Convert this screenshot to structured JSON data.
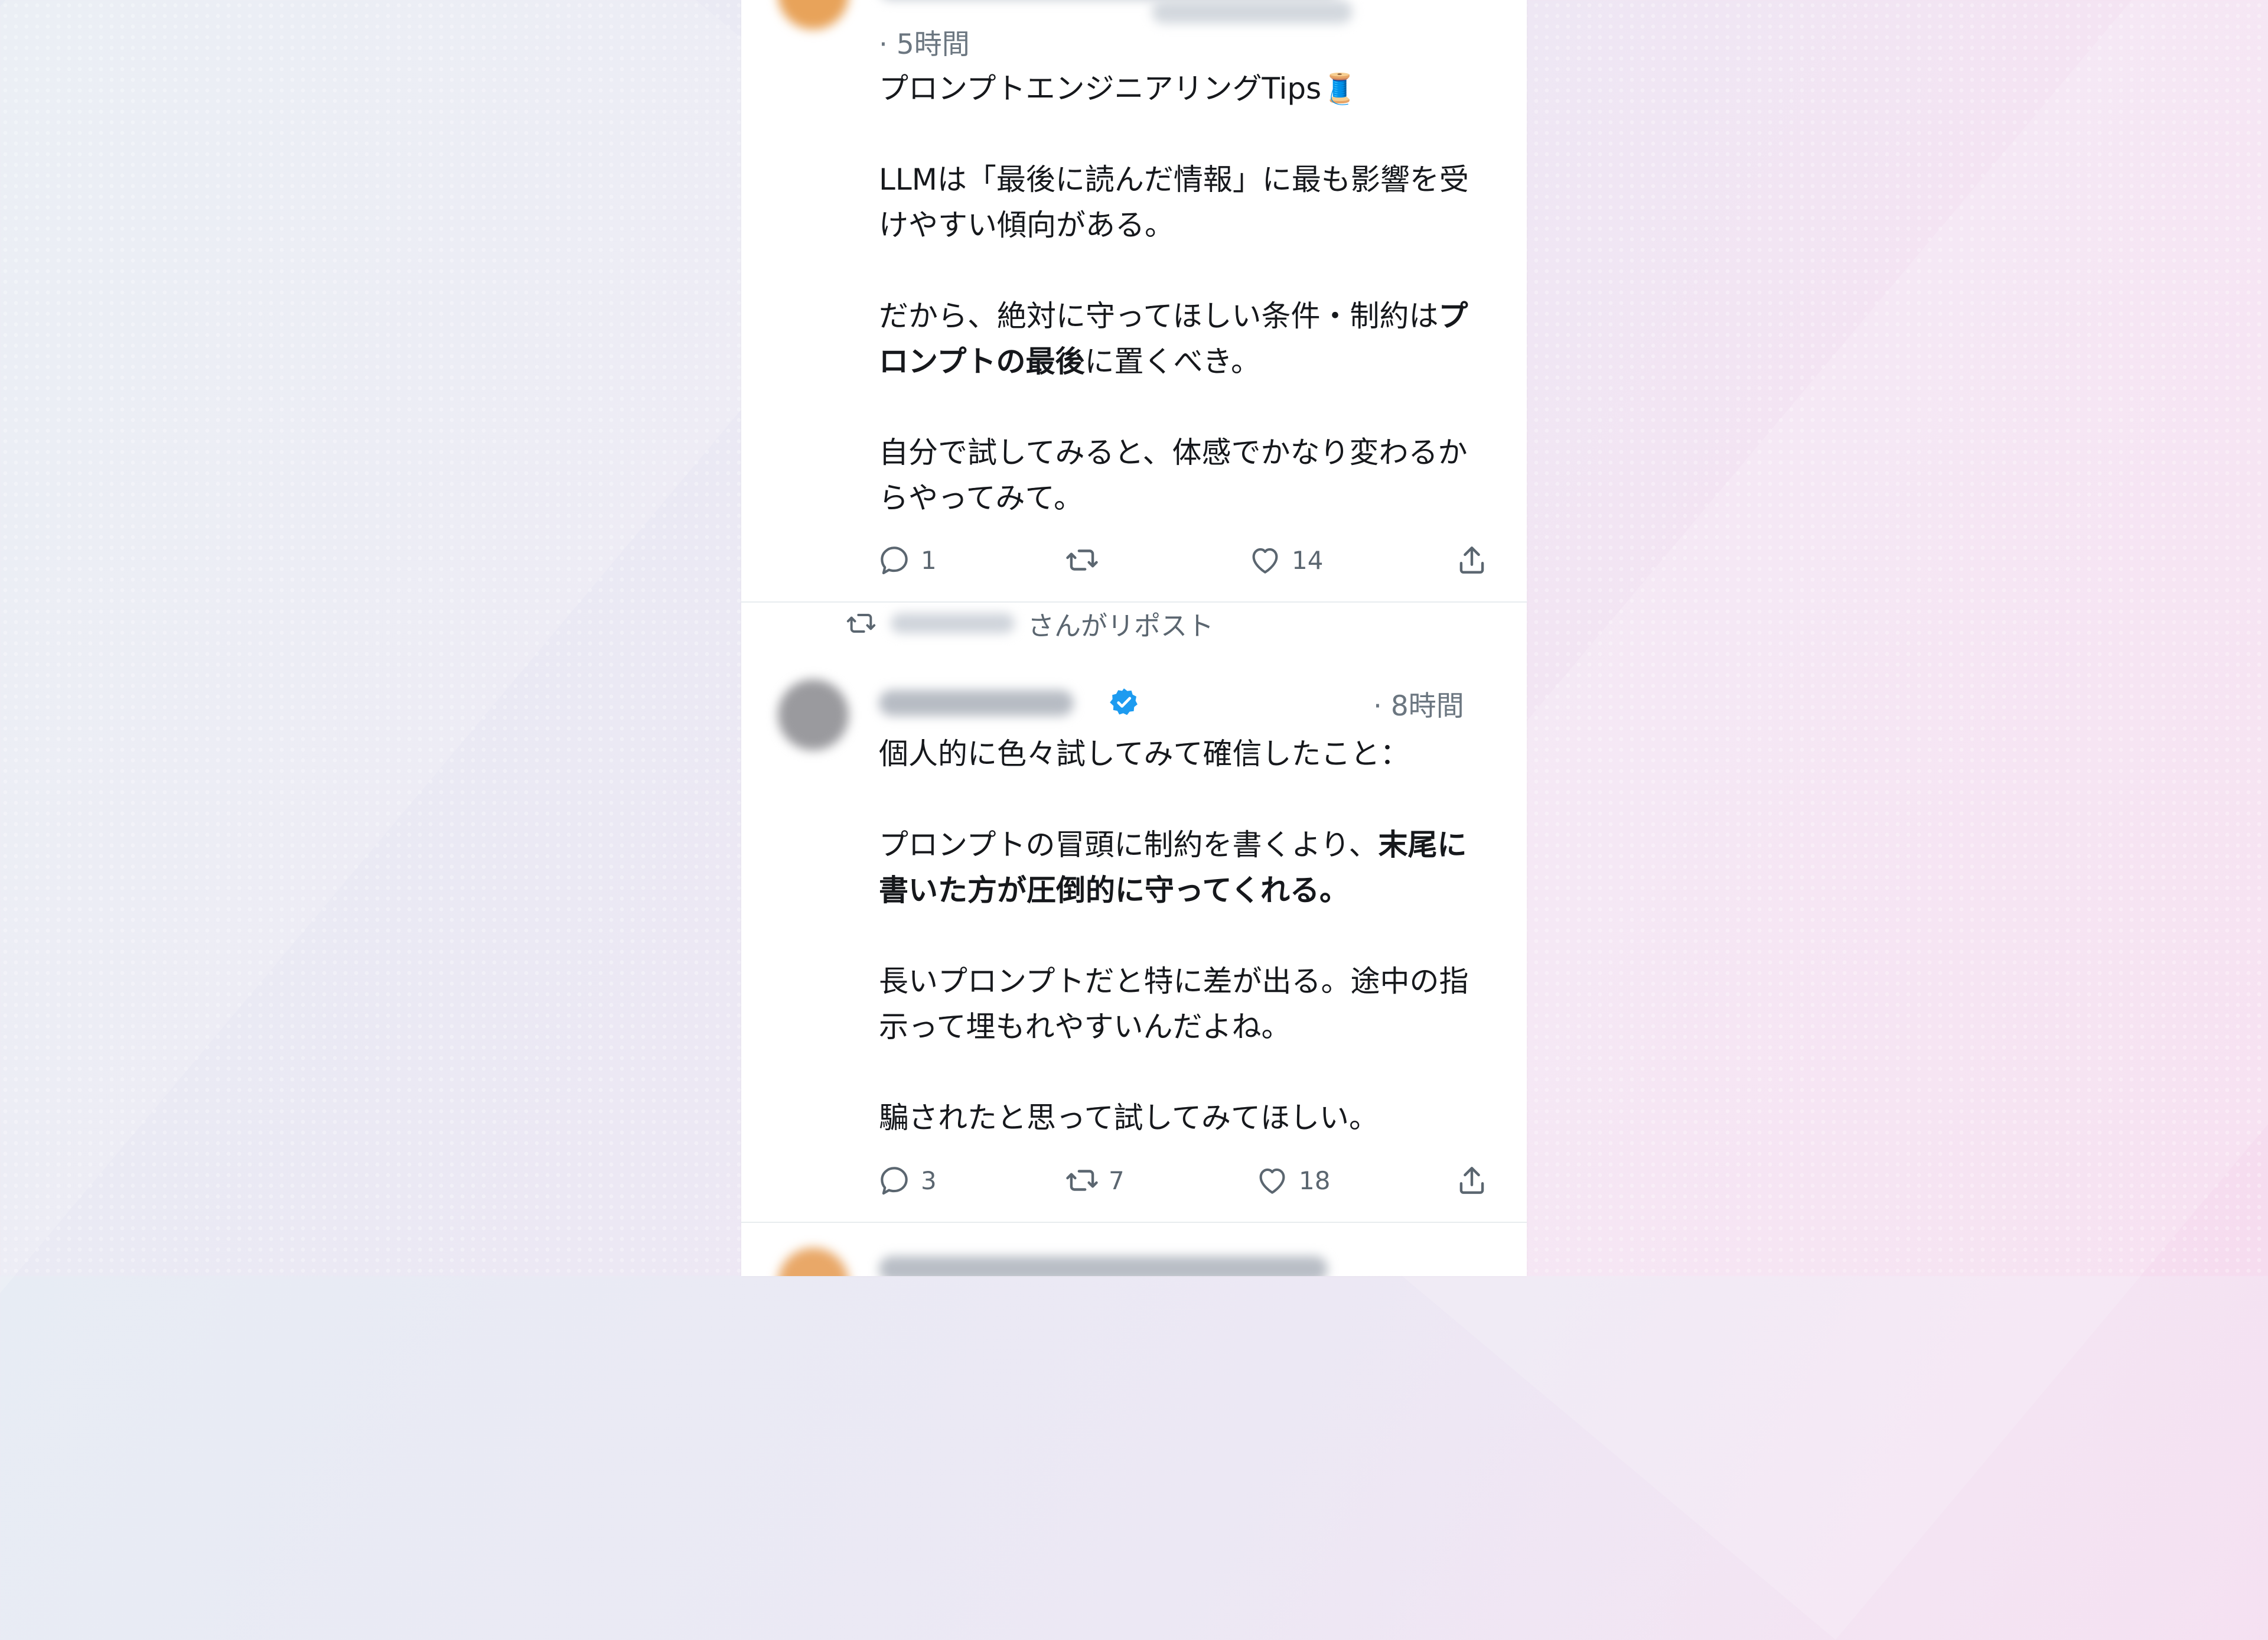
{
  "tweets": [
    {
      "time": "· 5時間",
      "paragraphs": [
        [
          {
            "t": "プロンプトエンジニアリングTips🧵"
          }
        ],
        [
          {
            "t": "LLMは「最後に読んだ情報」に最も影響を受けやすい傾向がある。"
          }
        ],
        [
          {
            "t": "だから、絶対に守ってほしい条件・制約は"
          },
          {
            "t": "プロンプトの最後",
            "b": true
          },
          {
            "t": "に置くべき。"
          }
        ],
        [
          {
            "t": "自分で試してみると、体感でかなり変わるからやってみて。"
          }
        ]
      ],
      "replies": "1",
      "reposts": "",
      "likes": "14"
    },
    {
      "repost_label": "さんがリポスト",
      "time": "· 8時間",
      "paragraphs": [
        [
          {
            "t": "個人的に色々試してみて確信したこと："
          }
        ],
        [
          {
            "t": "プロンプトの冒頭に制約を書くより、"
          },
          {
            "t": "末尾に書いた方が圧倒的に守ってくれる。",
            "b": true
          }
        ],
        [
          {
            "t": "長いプロンプトだと特に差が出る。途中の指示って埋もれやすいんだよね。"
          }
        ],
        [
          {
            "t": "騙されたと思って試してみてほしい。"
          }
        ]
      ],
      "replies": "3",
      "reposts": "7",
      "likes": "18"
    }
  ],
  "icons": {
    "reply": "reply-icon",
    "repost": "repost-icon",
    "like": "heart-icon",
    "share": "share-icon",
    "verified": "verified-badge-icon"
  },
  "colors": {
    "verified": "#1d9bf0",
    "text": "#16181c",
    "muted": "#5b6670"
  }
}
